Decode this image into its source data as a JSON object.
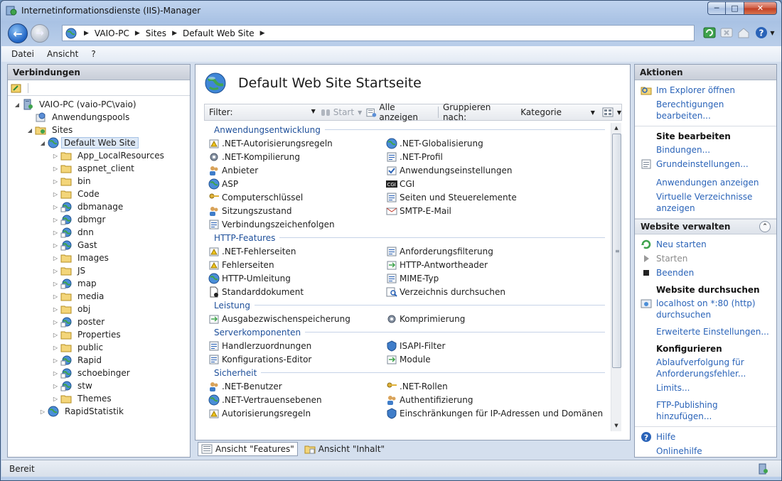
{
  "window": {
    "title": "Internetinformationsdienste (IIS)-Manager"
  },
  "address": {
    "crumbs": [
      "VAIO-PC",
      "Sites",
      "Default Web Site"
    ]
  },
  "menu": [
    "Datei",
    "Ansicht",
    "?"
  ],
  "connections": {
    "title": "Verbindungen",
    "root": "VAIO-PC (vaio-PC\\vaio)",
    "app_pools": "Anwendungspools",
    "sites": "Sites",
    "site": "Default Web Site",
    "children": [
      {
        "label": "App_LocalResources",
        "type": "folder"
      },
      {
        "label": "aspnet_client",
        "type": "folder"
      },
      {
        "label": "bin",
        "type": "folder"
      },
      {
        "label": "Code",
        "type": "folder"
      },
      {
        "label": "dbmanage",
        "type": "app"
      },
      {
        "label": "dbmgr",
        "type": "app"
      },
      {
        "label": "dnn",
        "type": "app"
      },
      {
        "label": "Gast",
        "type": "app"
      },
      {
        "label": "Images",
        "type": "folder"
      },
      {
        "label": "JS",
        "type": "folder"
      },
      {
        "label": "map",
        "type": "app"
      },
      {
        "label": "media",
        "type": "folder"
      },
      {
        "label": "obj",
        "type": "folder"
      },
      {
        "label": "poster",
        "type": "app"
      },
      {
        "label": "Properties",
        "type": "folder"
      },
      {
        "label": "public",
        "type": "folder"
      },
      {
        "label": "Rapid",
        "type": "app"
      },
      {
        "label": "schoebinger",
        "type": "app"
      },
      {
        "label": "stw",
        "type": "app"
      },
      {
        "label": "Themes",
        "type": "folder"
      }
    ],
    "other_site": "RapidStatistik"
  },
  "center": {
    "title": "Default Web Site Startseite",
    "filter_label": "Filter:",
    "filter_value": "",
    "start_label": "Start",
    "show_all_label": "Alle anzeigen",
    "group_label": "Gruppieren nach:",
    "group_value": "Kategorie",
    "categories": [
      {
        "name": "Anwendungsentwicklung",
        "items": [
          ".NET-Autorisierungsregeln",
          ".NET-Globalisierung",
          ".NET-Kompilierung",
          ".NET-Profil",
          "Anbieter",
          "Anwendungseinstellungen",
          "ASP",
          "CGI",
          "Computerschlüssel",
          "Seiten und Steuerelemente",
          "Sitzungszustand",
          "SMTP-E-Mail",
          "Verbindungszeichenfolgen"
        ]
      },
      {
        "name": "HTTP-Features",
        "items": [
          ".NET-Fehlerseiten",
          "Anforderungsfilterung",
          "Fehlerseiten",
          "HTTP-Antwortheader",
          "HTTP-Umleitung",
          "MIME-Typ",
          "Standarddokument",
          "Verzeichnis durchsuchen"
        ]
      },
      {
        "name": "Leistung",
        "items": [
          "Ausgabezwischenspeicherung",
          "Komprimierung"
        ]
      },
      {
        "name": "Serverkomponenten",
        "items": [
          "Handlerzuordnungen",
          "ISAPI-Filter",
          "Konfigurations-Editor",
          "Module"
        ]
      },
      {
        "name": "Sicherheit",
        "items": [
          ".NET-Benutzer",
          ".NET-Rollen",
          ".NET-Vertrauensebenen",
          "Authentifizierung",
          "Autorisierungsregeln",
          "Einschränkungen für IP-Adressen und Domänen"
        ]
      }
    ],
    "view_tabs": [
      "Ansicht \"Features\"",
      "Ansicht \"Inhalt\""
    ]
  },
  "actions": {
    "title": "Aktionen",
    "explore": "Im Explorer öffnen",
    "permissions": "Berechtigungen bearbeiten...",
    "edit_site_head": "Site bearbeiten",
    "bindings": "Bindungen...",
    "basic_settings": "Grundeinstellungen...",
    "view_apps": "Anwendungen anzeigen",
    "view_vdirs": "Virtuelle Verzeichnisse anzeigen",
    "manage_head": "Website verwalten",
    "restart": "Neu starten",
    "start": "Starten",
    "stop": "Beenden",
    "browse_head": "Website durchsuchen",
    "browse_link": "localhost on *:80 (http) durchsuchen",
    "advanced": "Erweiterte Einstellungen...",
    "configure_head": "Konfigurieren",
    "failed_tracing": "Ablaufverfolgung für Anforderungsfehler...",
    "limits": "Limits...",
    "ftp": "FTP-Publishing hinzufügen...",
    "help": "Hilfe",
    "online_help": "Onlinehilfe"
  },
  "status": {
    "text": "Bereit"
  }
}
